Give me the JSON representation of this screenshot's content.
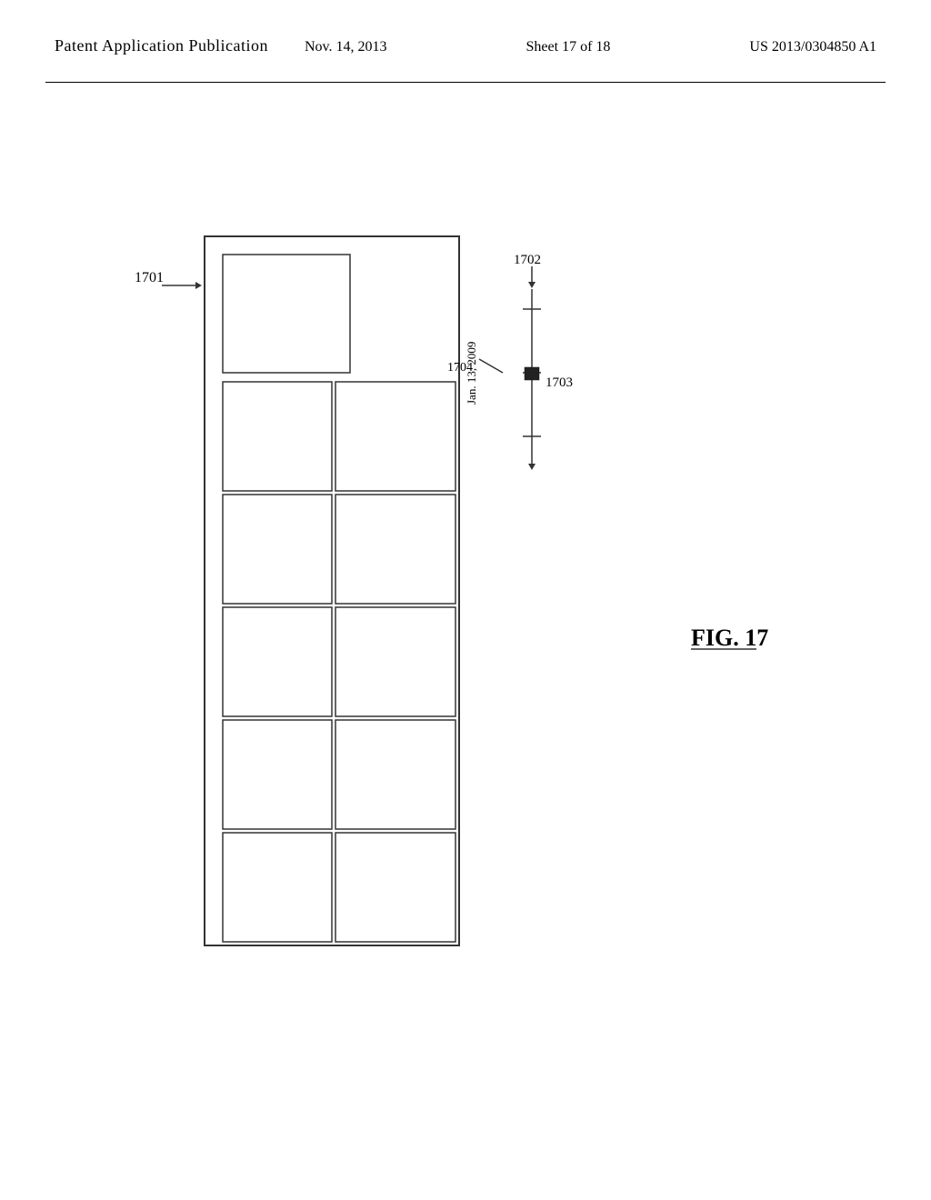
{
  "header": {
    "title": "Patent Application Publication",
    "date": "Nov. 14, 2013",
    "sheet": "Sheet 17 of 18",
    "patent": "US 2013/0304850 A1"
  },
  "figure": {
    "label": "FIG. 17",
    "number": "17",
    "labels": {
      "l1701": "1701",
      "l1702": "1702",
      "l1703": "1703",
      "l1704": "1704",
      "date_label": "Jan. 13, 2009"
    }
  }
}
